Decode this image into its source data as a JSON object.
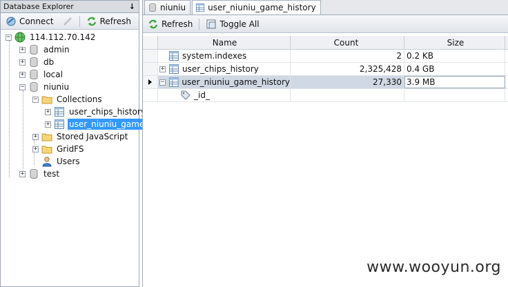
{
  "left_panel": {
    "title": "Database Explorer",
    "pin_glyph": "↓",
    "toolbar": {
      "connect_label": "Connect",
      "refresh_label": "Refresh"
    },
    "tree": {
      "server": "114.112.70.142",
      "databases": [
        "admin",
        "db",
        "local",
        "niuniu",
        "test"
      ],
      "niuniu_children": {
        "collections": "Collections",
        "collection_items": [
          "user_chips_history",
          "user_niuniu_game_"
        ],
        "stored_js": "Stored JavaScript",
        "gridfs": "GridFS",
        "users": "Users"
      }
    }
  },
  "right_panel": {
    "tabs": [
      {
        "label": "niuniu"
      },
      {
        "label": "user_niuniu_game_history"
      }
    ],
    "toolbar": {
      "refresh_label": "Refresh",
      "toggle_all_label": "Toggle All"
    },
    "grid": {
      "headers": [
        "Name",
        "Count",
        "Size"
      ],
      "rows": [
        {
          "name": "system.indexes",
          "count": "2",
          "size": "0.2 KB"
        },
        {
          "name": "user_chips_history",
          "count": "2,325,428",
          "size": "0.4 GB"
        },
        {
          "name": "user_niuniu_game_history",
          "count": "27,330",
          "size": "3.9 MB"
        }
      ],
      "child_row": {
        "name": "_id_"
      }
    }
  },
  "watermark": "www.wooyun.org",
  "colors": {
    "selection": "#3399ff",
    "row_selected": "#cfd8e3",
    "header_bg": "#eef0f3"
  }
}
